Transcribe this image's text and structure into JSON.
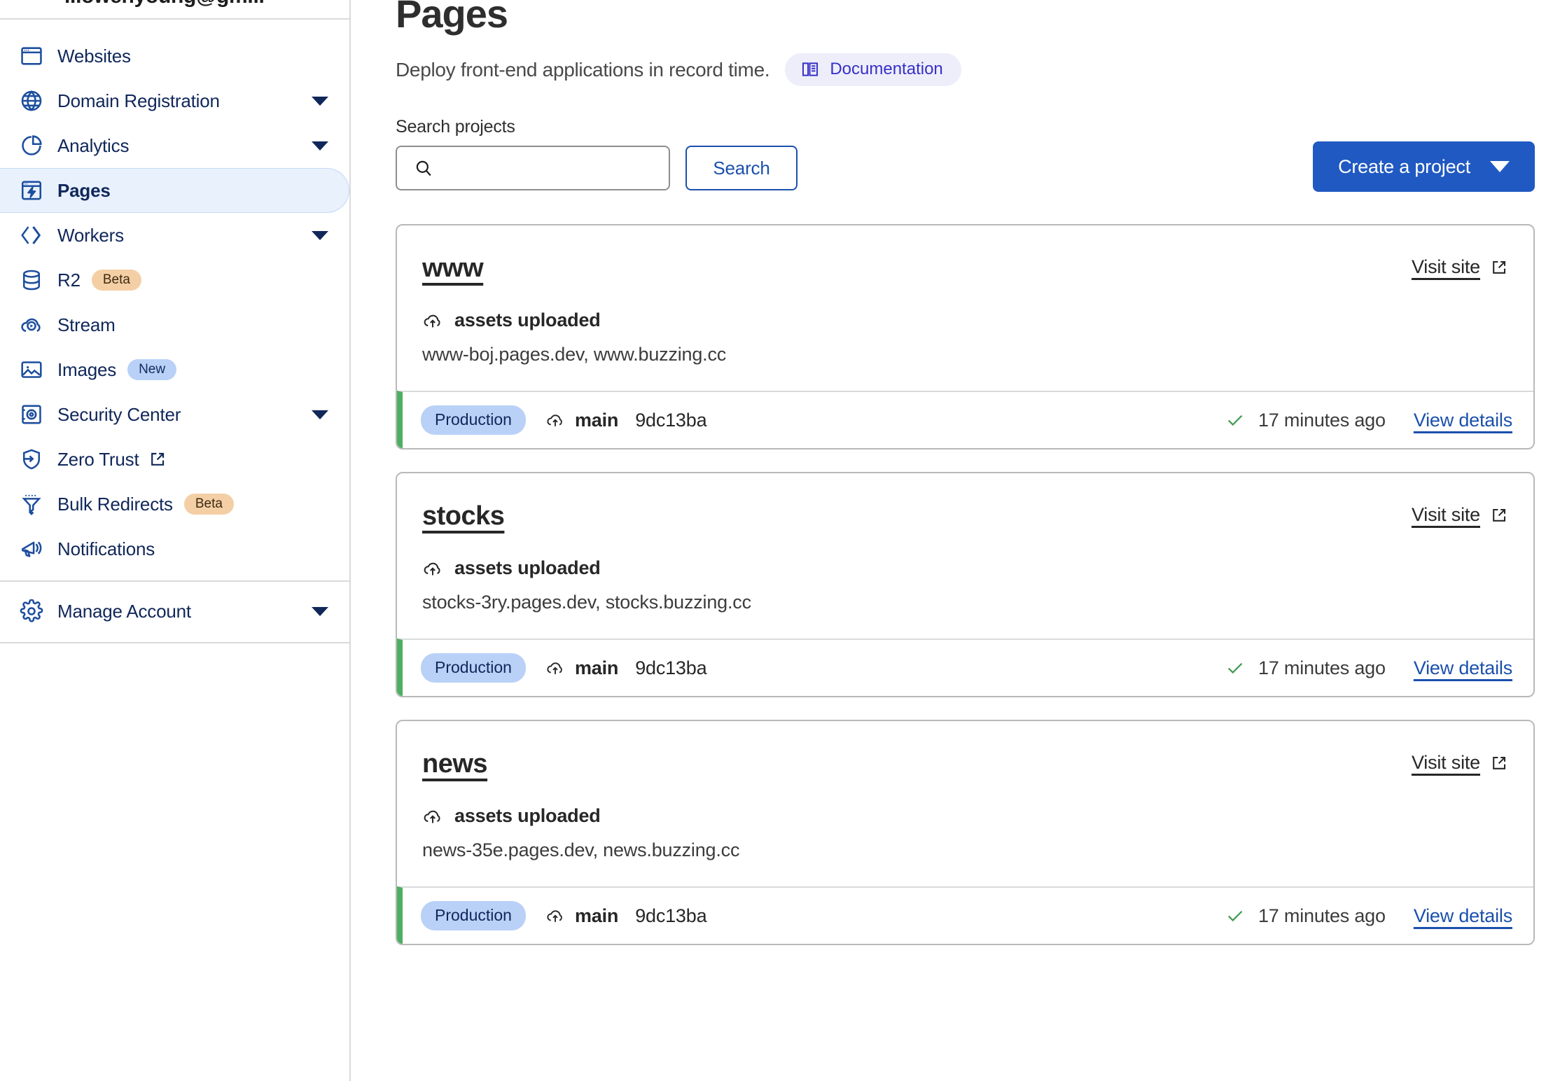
{
  "sidebar": {
    "account_email": "...owenyoung@gm...",
    "items": [
      {
        "label": "Websites",
        "icon": "browser-window-icon",
        "caret": false,
        "badge": null,
        "external": false,
        "active": false
      },
      {
        "label": "Domain Registration",
        "icon": "globe-www-icon",
        "caret": true,
        "badge": null,
        "external": false,
        "active": false
      },
      {
        "label": "Analytics",
        "icon": "pie-chart-icon",
        "caret": true,
        "badge": null,
        "external": false,
        "active": false
      },
      {
        "label": "Pages",
        "icon": "pages-bolt-icon",
        "caret": false,
        "badge": null,
        "external": false,
        "active": true
      },
      {
        "label": "Workers",
        "icon": "workers-chevron-icon",
        "caret": true,
        "badge": null,
        "external": false,
        "active": false
      },
      {
        "label": "R2",
        "icon": "database-icon",
        "caret": false,
        "badge": "Beta",
        "external": false,
        "active": false
      },
      {
        "label": "Stream",
        "icon": "cloud-play-icon",
        "caret": false,
        "badge": null,
        "external": false,
        "active": false
      },
      {
        "label": "Images",
        "icon": "image-icon",
        "caret": false,
        "badge": "New",
        "external": false,
        "active": false
      },
      {
        "label": "Security Center",
        "icon": "safe-vault-icon",
        "caret": true,
        "badge": null,
        "external": false,
        "active": false
      },
      {
        "label": "Zero Trust",
        "icon": "shield-arrow-icon",
        "caret": false,
        "badge": null,
        "external": true,
        "active": false
      },
      {
        "label": "Bulk Redirects",
        "icon": "funnel-icon",
        "caret": false,
        "badge": "Beta",
        "external": false,
        "active": false
      },
      {
        "label": "Notifications",
        "icon": "megaphone-icon",
        "caret": false,
        "badge": null,
        "external": false,
        "active": false
      }
    ],
    "footer": [
      {
        "label": "Manage Account",
        "icon": "gear-icon",
        "caret": true
      }
    ]
  },
  "header": {
    "title": "Pages",
    "subtitle": "Deploy front-end applications in record time.",
    "documentation_label": "Documentation",
    "documentation_icon": "book-icon"
  },
  "search": {
    "label": "Search projects",
    "value": "",
    "placeholder": "",
    "icon": "search-icon",
    "button_label": "Search"
  },
  "actions": {
    "create_project_label": "Create a project",
    "create_project_caret": "chevron-down-icon"
  },
  "projects": [
    {
      "name": "www",
      "visit_site_label": "Visit site",
      "status_text": "assets uploaded",
      "status_icon": "cloud-upload-icon",
      "domains": "www-boj.pages.dev, www.buzzing.cc",
      "deployment": {
        "environment": "Production",
        "branch": "main",
        "branch_icon": "cloud-upload-icon",
        "commit": "9dc13ba",
        "state_icon": "check-icon",
        "time_ago": "17 minutes ago",
        "details_label": "View details"
      }
    },
    {
      "name": "stocks",
      "visit_site_label": "Visit site",
      "status_text": "assets uploaded",
      "status_icon": "cloud-upload-icon",
      "domains": "stocks-3ry.pages.dev, stocks.buzzing.cc",
      "deployment": {
        "environment": "Production",
        "branch": "main",
        "branch_icon": "cloud-upload-icon",
        "commit": "9dc13ba",
        "state_icon": "check-icon",
        "time_ago": "17 minutes ago",
        "details_label": "View details"
      }
    },
    {
      "name": "news",
      "visit_site_label": "Visit site",
      "status_text": "assets uploaded",
      "status_icon": "cloud-upload-icon",
      "domains": "news-35e.pages.dev, news.buzzing.cc",
      "deployment": {
        "environment": "Production",
        "branch": "main",
        "branch_icon": "cloud-upload-icon",
        "commit": "9dc13ba",
        "state_icon": "check-icon",
        "time_ago": "17 minutes ago",
        "details_label": "View details"
      }
    }
  ],
  "colors": {
    "accent_blue": "#2059c2",
    "link_blue": "#1b50ac",
    "nav_text": "#10275a",
    "icon_blue": "#1d4e9e",
    "active_bg": "#e9f1fd",
    "badge_prod_bg": "#b9d1f7",
    "badge_beta_bg": "#f4cfa5",
    "badge_new_bg": "#b9d1f7",
    "doc_badge_bg": "#eeeefb",
    "doc_badge_fg": "#3730c8",
    "deploy_bar_green": "#4caf62",
    "check_green": "#3f9a4e",
    "border_gray": "#b9b9b9"
  }
}
